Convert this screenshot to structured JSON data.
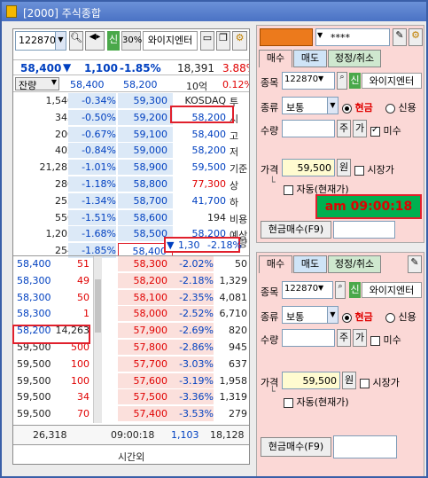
{
  "window": {
    "title": "[2000] 주식종합"
  },
  "toolbar": {
    "code": "122870",
    "badge": "신",
    "pct": "30%",
    "name": "와이지엔터"
  },
  "summary": {
    "price": "58,400",
    "arrow": "▼",
    "change": "1,100",
    "rate": "-1.85%",
    "volume": "18,391",
    "ratio": "3.88%"
  },
  "hdr": {
    "remain": "잔량",
    "c1": "58,400",
    "c2": "58,200",
    "unit": "10억",
    "ratio": "0.12%"
  },
  "sell_rows": [
    {
      "qty": "1,540",
      "rate": "-0.34%",
      "price": "59,300"
    },
    {
      "qty": "345",
      "rate": "-0.50%",
      "price": "59,200"
    },
    {
      "qty": "200",
      "rate": "-0.67%",
      "price": "59,100"
    },
    {
      "qty": "402",
      "rate": "-0.84%",
      "price": "59,000"
    },
    {
      "qty": "21,287",
      "rate": "-1.01%",
      "price": "58,900"
    },
    {
      "qty": "280",
      "rate": "-1.18%",
      "price": "58,800"
    },
    {
      "qty": "255",
      "rate": "-1.34%",
      "price": "58,700"
    },
    {
      "qty": "550",
      "rate": "-1.51%",
      "price": "58,600"
    },
    {
      "qty": "1,205",
      "rate": "-1.68%",
      "price": "58,500"
    },
    {
      "qty": "254",
      "rate": "-1.85%",
      "price": "58,400"
    }
  ],
  "info_rows": [
    {
      "val": "KOSDAQ",
      "lbl": "투"
    },
    {
      "val": "58,200",
      "lbl": "시"
    },
    {
      "val": "58,400",
      "lbl": "고"
    },
    {
      "val": "58,200",
      "lbl": "저"
    },
    {
      "val": "59,500",
      "lbl": "기준"
    },
    {
      "val": "77,300",
      "lbl": "상"
    },
    {
      "val": "41,700",
      "lbl": "하"
    },
    {
      "val": "194",
      "lbl": "비용"
    },
    {
      "val": "58,200",
      "lbl": "예상"
    },
    {
      "val": "14,263",
      "lbl": "수량"
    }
  ],
  "expected": {
    "arrow": "▼",
    "change": "1,30",
    "rate": "-2.18%"
  },
  "tick_rows": [
    {
      "price": "58,400",
      "qty": "51"
    },
    {
      "price": "58,300",
      "qty": "49"
    },
    {
      "price": "58,300",
      "qty": "50"
    },
    {
      "price": "58,300",
      "qty": "1"
    },
    {
      "price": "58,200",
      "qty": "14,263"
    },
    {
      "price": "59,500",
      "qty": "500"
    },
    {
      "price": "59,500",
      "qty": "100"
    },
    {
      "price": "59,500",
      "qty": "100"
    },
    {
      "price": "59,500",
      "qty": "34"
    },
    {
      "price": "59,500",
      "qty": "70"
    }
  ],
  "buy_rows": [
    {
      "price": "58,300",
      "rate": "-2.02%",
      "qty": "50"
    },
    {
      "price": "58,200",
      "rate": "-2.18%",
      "qty": "1,329"
    },
    {
      "price": "58,100",
      "rate": "-2.35%",
      "qty": "4,081"
    },
    {
      "price": "58,000",
      "rate": "-2.52%",
      "qty": "6,710"
    },
    {
      "price": "57,900",
      "rate": "-2.69%",
      "qty": "820"
    },
    {
      "price": "57,800",
      "rate": "-2.86%",
      "qty": "945"
    },
    {
      "price": "57,700",
      "rate": "-3.03%",
      "qty": "637"
    },
    {
      "price": "57,600",
      "rate": "-3.19%",
      "qty": "1,958"
    },
    {
      "price": "57,500",
      "rate": "-3.36%",
      "qty": "1,319"
    },
    {
      "price": "57,400",
      "rate": "-3.53%",
      "qty": "279"
    }
  ],
  "footer": {
    "sell_total": "26,318",
    "time": "09:00:18",
    "buy_total_a": "1,103",
    "buy_total_b": "18,128",
    "after": "시간외"
  },
  "order1": {
    "account_mask": "****",
    "tab_buy": "매수",
    "tab_sell": "매도",
    "tab_modify": "정정/취소",
    "lbl_code": "종목",
    "code": "122870",
    "badge": "신",
    "name": "와이지엔터",
    "lbl_type": "종류",
    "type": "보통",
    "cash": "현금",
    "credit": "신용",
    "lbl_qty": "수량",
    "qty_btn": "주",
    "buy_btn": "가",
    "misu": "미수",
    "lbl_price": "가격",
    "price": "59,500",
    "won": "원",
    "market": "시장가",
    "auto": "자동(현재가)",
    "submit": "현금매수(F9)",
    "clock": "am 09:00:18"
  },
  "order2": {
    "tab_buy": "매수",
    "tab_sell": "매도",
    "tab_modify": "정정/취소",
    "lbl_code": "종목",
    "code": "122870",
    "badge": "신",
    "name": "와이지엔터",
    "lbl_type": "종류",
    "type": "보통",
    "cash": "현금",
    "credit": "신용",
    "lbl_qty": "수량",
    "qty_btn": "주",
    "buy_btn": "가",
    "misu": "미수",
    "lbl_price": "가격",
    "price": "59,500",
    "won": "원",
    "market": "시장가",
    "auto": "자동(현재가)",
    "submit": "현금매수(F9)"
  },
  "colors": {
    "sell_bg": "#dce9f7",
    "buy_bg": "#fbe0dc",
    "highlight": "#e0202c",
    "clock_bg": "#00b050",
    "clock_text": "#e00000",
    "account_bar": "#ec7a1c"
  }
}
